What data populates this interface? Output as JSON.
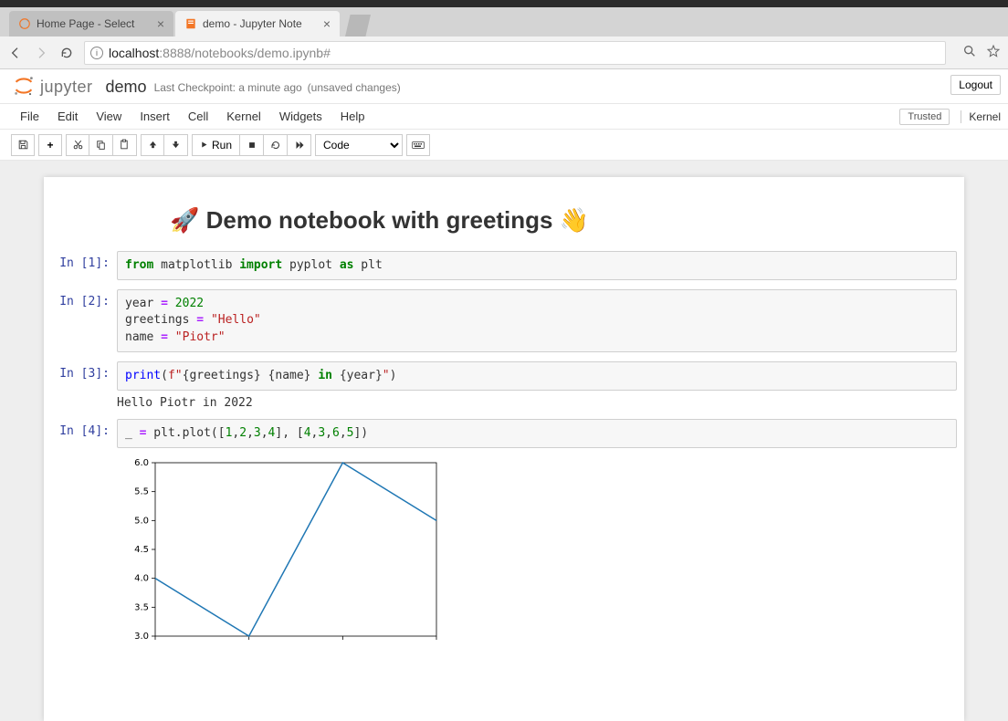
{
  "browser": {
    "tabs": [
      {
        "title": "Home Page - Select",
        "active": false,
        "icon": "jupyter"
      },
      {
        "title": "demo - Jupyter Note",
        "active": true,
        "icon": "notebook"
      }
    ],
    "url_host": "localhost",
    "url_rest": ":8888/notebooks/demo.ipynb#"
  },
  "header": {
    "logo_text": "jupyter",
    "notebook_name": "demo",
    "checkpoint": "Last Checkpoint: a minute ago",
    "unsaved": "(unsaved changes)",
    "logout": "Logout"
  },
  "menubar": {
    "items": [
      "File",
      "Edit",
      "View",
      "Insert",
      "Cell",
      "Kernel",
      "Widgets",
      "Help"
    ],
    "trusted": "Trusted",
    "kernel": "Kernel"
  },
  "toolbar": {
    "run_label": "Run",
    "cell_type": "Code"
  },
  "notebook": {
    "title": "🚀 Demo notebook with greetings 👋",
    "cells": [
      {
        "prompt": "In [1]:"
      },
      {
        "prompt": "In [2]:"
      },
      {
        "prompt": "In [3]:",
        "output_text": "Hello Piotr in 2022"
      },
      {
        "prompt": "In [4]:"
      }
    ]
  },
  "chart_data": {
    "type": "line",
    "x": [
      1,
      2,
      3,
      4
    ],
    "values": [
      4,
      3,
      6,
      5
    ],
    "y_ticks": [
      3.0,
      3.5,
      4.0,
      4.5,
      5.0,
      5.5,
      6.0
    ],
    "ylim": [
      3.0,
      6.0
    ],
    "xlabel": "",
    "ylabel": ""
  }
}
